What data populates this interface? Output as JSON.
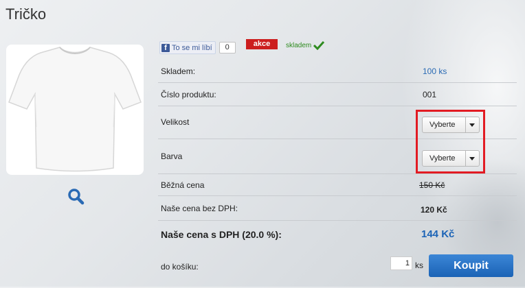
{
  "product": {
    "title": "Tričko"
  },
  "social": {
    "like_label": "To se mi líbí",
    "like_count": "0"
  },
  "badges": {
    "sale": "akce",
    "stock": "skladem"
  },
  "details": {
    "stock_label": "Skladem:",
    "stock_value": "100 ks",
    "code_label": "Číslo produktu:",
    "code_value": "001",
    "size_label": "Velikost",
    "size_select": "Vyberte",
    "color_label": "Barva",
    "color_select": "Vyberte",
    "regular_price_label": "Běžná cena",
    "regular_price_value": "150 Kč",
    "price_no_vat_label": "Naše cena bez DPH:",
    "price_no_vat_value": "120 Kč",
    "price_vat_label": "Naše cena s DPH (20.0 %):",
    "price_vat_value": "144 Kč"
  },
  "cart": {
    "label": "do košíku:",
    "quantity": "1",
    "unit": "ks",
    "buy_label": "Koupit"
  },
  "colors": {
    "accent": "#1b63b6",
    "sale": "#cc1e1e",
    "stock": "#2e8b1f",
    "highlight": "#e21b23"
  }
}
